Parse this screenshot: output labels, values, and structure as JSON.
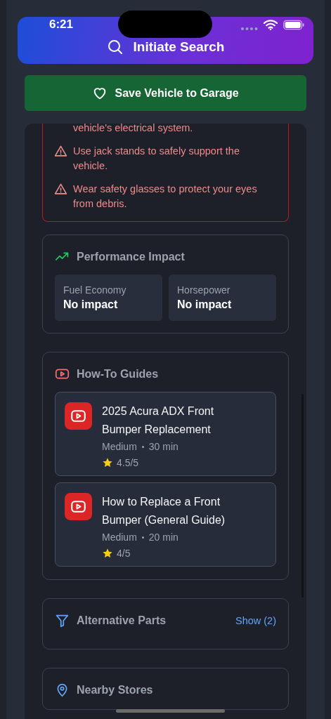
{
  "status_bar": {
    "time": "6:21"
  },
  "header": {
    "title": "Initiate Search"
  },
  "save_button": {
    "label": "Save Vehicle to Garage"
  },
  "safety_warnings": [
    {
      "kind": "continued",
      "text": "vehicle's electrical system."
    },
    {
      "kind": "warning",
      "text": "Use jack stands to safely support the vehicle."
    },
    {
      "kind": "warning",
      "text": "Wear safety glasses to protect your eyes from debris."
    }
  ],
  "performance_impact": {
    "title": "Performance Impact",
    "metrics": [
      {
        "label": "Fuel Economy",
        "value": "No impact"
      },
      {
        "label": "Horsepower",
        "value": "No impact"
      }
    ]
  },
  "how_to_guides": {
    "title": "How-To Guides",
    "videos": [
      {
        "title": "2025 Acura ADX Front Bumper Replacement",
        "difficulty": "Medium",
        "duration": "30 min",
        "rating": "4.5/5"
      },
      {
        "title": "How to Replace a Front Bumper (General Guide)",
        "difficulty": "Medium",
        "duration": "20 min",
        "rating": "4/5"
      }
    ]
  },
  "alternative_parts": {
    "title": "Alternative Parts",
    "action": "Show (2)"
  },
  "nearby_stores": {
    "title": "Nearby Stores"
  }
}
